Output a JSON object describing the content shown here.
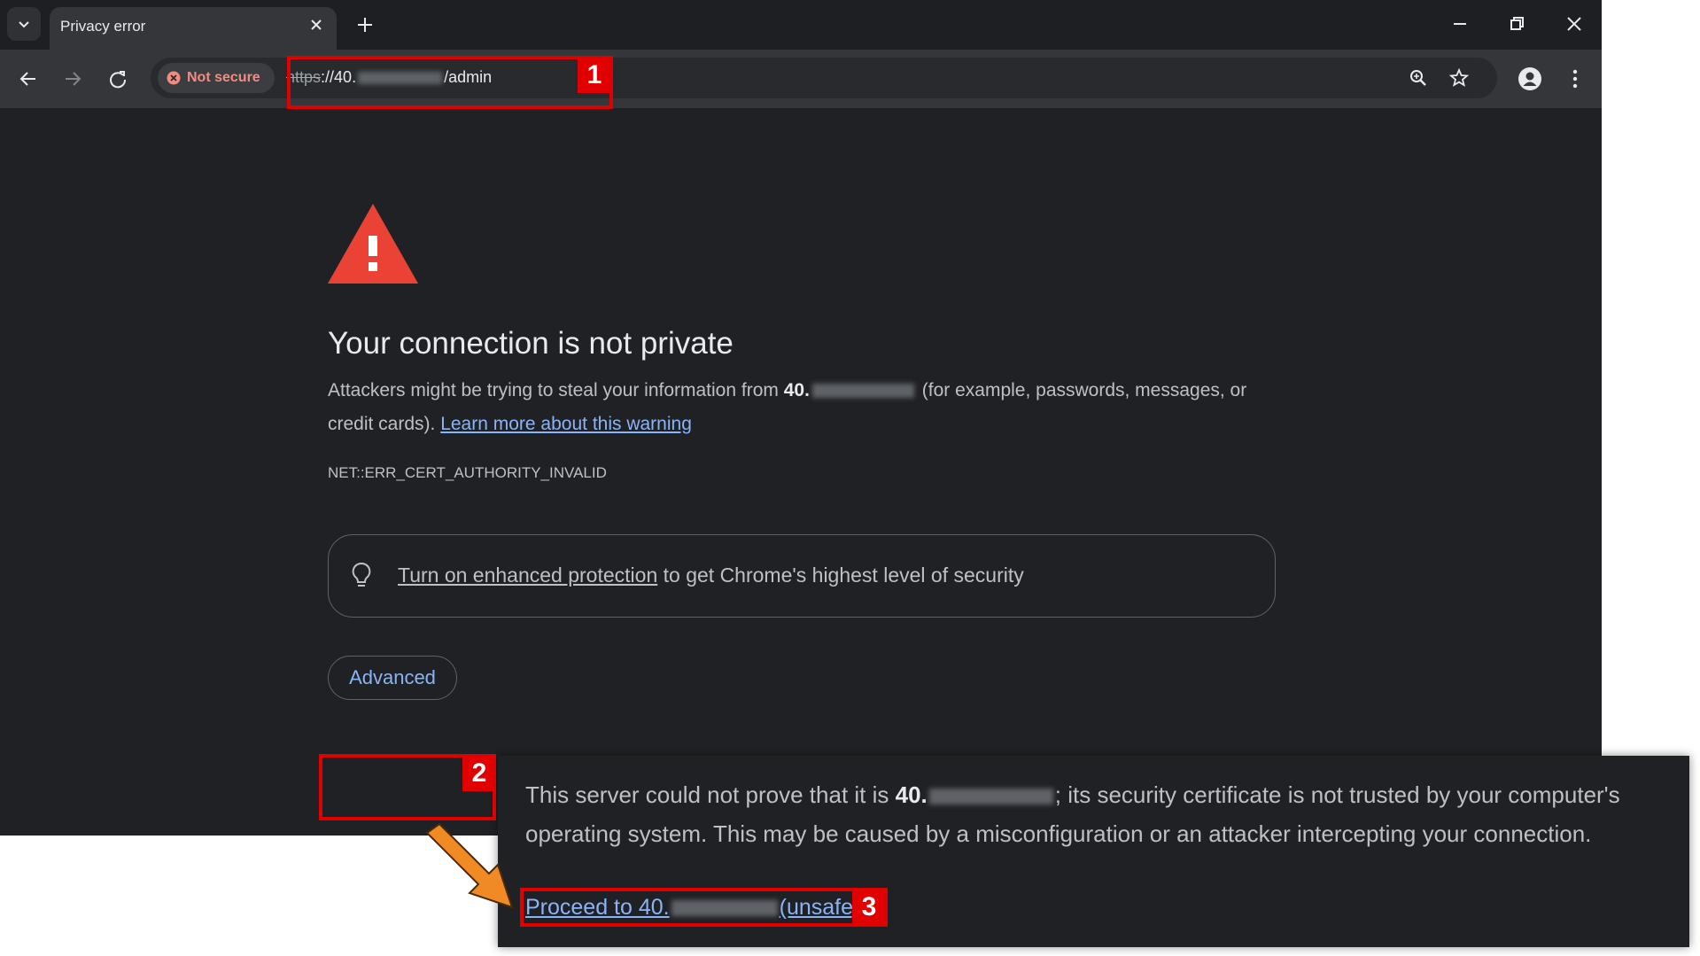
{
  "browser": {
    "tab": {
      "title": "Privacy error"
    },
    "icons": {
      "tab_search": "chevron-down-icon",
      "tab_close": "close-icon",
      "new_tab": "plus-icon",
      "minimize": "minimize-icon",
      "restore": "restore-icon",
      "close_window": "close-icon",
      "back": "back-arrow-icon",
      "forward": "forward-arrow-icon",
      "reload": "reload-icon",
      "zoom": "zoom-icon",
      "bookmark": "star-icon",
      "profile": "profile-icon",
      "menu": "kebab-menu-icon"
    },
    "omnibox": {
      "security_chip": "Not secure",
      "url_scheme": "https",
      "url_scheme_sep": "://",
      "url_host_prefix": "40.",
      "url_path": "/admin"
    }
  },
  "page": {
    "title": "Your connection is not private",
    "description_before": "Attackers might be trying to steal your information from ",
    "host_bold": "40.",
    "description_after": " (for example, passwords, messages, or credit cards). ",
    "learn_more": "Learn more about this warning",
    "error_code": "NET::ERR_CERT_AUTHORITY_INVALID",
    "enhanced_link": "Turn on enhanced protection",
    "enhanced_rest": " to get Chrome's highest level of security",
    "advanced_button": "Advanced"
  },
  "advanced_panel": {
    "text_before": "This server could not prove that it is ",
    "host_bold": "40.",
    "text_after": "; its security certificate is not trusted by your computer's operating system. This may be caused by a misconfiguration or an attacker intercepting your connection.",
    "proceed_before": "Proceed to 40.",
    "proceed_after": "(unsafe)"
  },
  "annotations": {
    "badge1": "1",
    "badge2": "2",
    "badge3": "3"
  },
  "colors": {
    "background": "#202124",
    "link": "#8ab4f8",
    "warning_red": "#ea4335",
    "callout_red": "#e00000",
    "arrow_orange": "#f08a24"
  }
}
